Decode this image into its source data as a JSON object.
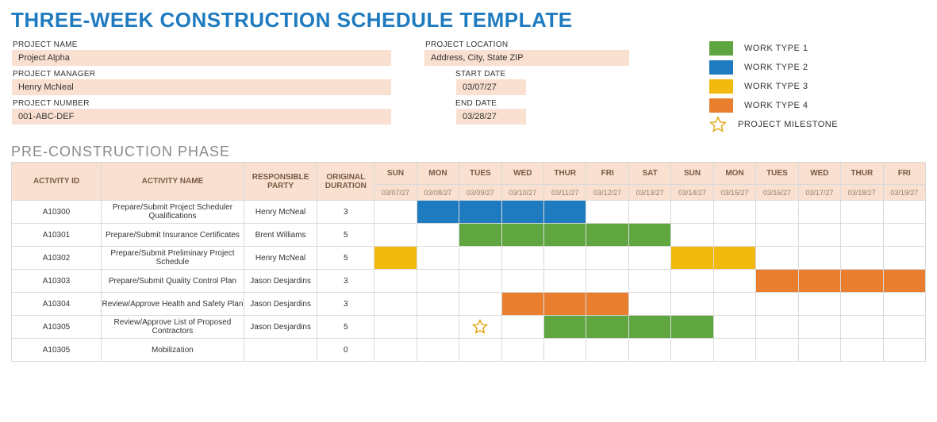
{
  "title": "THREE-WEEK CONSTRUCTION SCHEDULE TEMPLATE",
  "fields": {
    "project_name_label": "PROJECT NAME",
    "project_name": "Project Alpha",
    "project_manager_label": "PROJECT MANAGER",
    "project_manager": "Henry McNeal",
    "project_number_label": "PROJECT NUMBER",
    "project_number": "001-ABC-DEF",
    "project_location_label": "PROJECT LOCATION",
    "project_location": "Address, City, State ZIP",
    "start_date_label": "START DATE",
    "start_date": "03/07/27",
    "end_date_label": "END DATE",
    "end_date": "03/28/27"
  },
  "legend": {
    "work1": "WORK TYPE 1",
    "work2": "WORK TYPE 2",
    "work3": "WORK TYPE 3",
    "work4": "WORK TYPE 4",
    "milestone": "PROJECT MILESTONE"
  },
  "phase_title": "PRE-CONSTRUCTION PHASE",
  "columns": {
    "activity_id": "ACTIVITY ID",
    "activity_name": "ACTIVITY NAME",
    "responsible_party": "RESPONSIBLE PARTY",
    "original_duration": "ORIGINAL DURATION"
  },
  "days": [
    {
      "dow": "SUN",
      "date": "03/07/27"
    },
    {
      "dow": "MON",
      "date": "03/08/27"
    },
    {
      "dow": "TUES",
      "date": "03/09/27"
    },
    {
      "dow": "WED",
      "date": "03/10/27"
    },
    {
      "dow": "THUR",
      "date": "03/11/27"
    },
    {
      "dow": "FRI",
      "date": "03/12/27"
    },
    {
      "dow": "SAT",
      "date": "03/13/27"
    },
    {
      "dow": "SUN",
      "date": "03/14/27"
    },
    {
      "dow": "MON",
      "date": "03/15/27"
    },
    {
      "dow": "TUES",
      "date": "03/16/27"
    },
    {
      "dow": "WED",
      "date": "03/17/27"
    },
    {
      "dow": "THUR",
      "date": "03/18/27"
    },
    {
      "dow": "FRI",
      "date": "03/19/27"
    }
  ],
  "rows": [
    {
      "id": "A10300",
      "name": "Prepare/Submit Project Scheduler Qualifications",
      "party": "Henry McNeal",
      "dur": "3",
      "cells": [
        "",
        "blue",
        "blue",
        "blue",
        "blue",
        "",
        "",
        "",
        "",
        "",
        "",
        "",
        ""
      ]
    },
    {
      "id": "A10301",
      "name": "Prepare/Submit Insurance Certificates",
      "party": "Brent Williams",
      "dur": "5",
      "cells": [
        "",
        "",
        "green",
        "green",
        "green",
        "green",
        "green",
        "",
        "",
        "",
        "",
        "",
        ""
      ]
    },
    {
      "id": "A10302",
      "name": "Prepare/Submit Preliminary Project Schedule",
      "party": "Henry McNeal",
      "dur": "5",
      "cells": [
        "yellow",
        "",
        "",
        "",
        "",
        "",
        "",
        "yellow",
        "yellow",
        "",
        "",
        "",
        ""
      ]
    },
    {
      "id": "A10303",
      "name": "Prepare/Submit Quality Control Plan",
      "party": "Jason Desjardins",
      "dur": "3",
      "cells": [
        "",
        "",
        "",
        "",
        "",
        "",
        "",
        "",
        "",
        "orange",
        "orange",
        "orange",
        "orange"
      ]
    },
    {
      "id": "A10304",
      "name": "Review/Approve Health and Safety Plan",
      "party": "Jason Desjardins",
      "dur": "3",
      "cells": [
        "",
        "",
        "",
        "orange",
        "orange",
        "orange",
        "",
        "",
        "",
        "",
        "",
        "",
        ""
      ]
    },
    {
      "id": "A10305",
      "name": "Review/Approve List of Proposed Contractors",
      "party": "Jason Desjardins",
      "dur": "5",
      "cells": [
        "",
        "",
        "star",
        "",
        "green",
        "green",
        "green",
        "green",
        "",
        "",
        "",
        "",
        ""
      ]
    },
    {
      "id": "A10305",
      "name": "Mobilization",
      "party": "",
      "dur": "0",
      "cells": [
        "",
        "",
        "",
        "",
        "",
        "",
        "",
        "",
        "",
        "",
        "",
        "",
        ""
      ]
    }
  ]
}
